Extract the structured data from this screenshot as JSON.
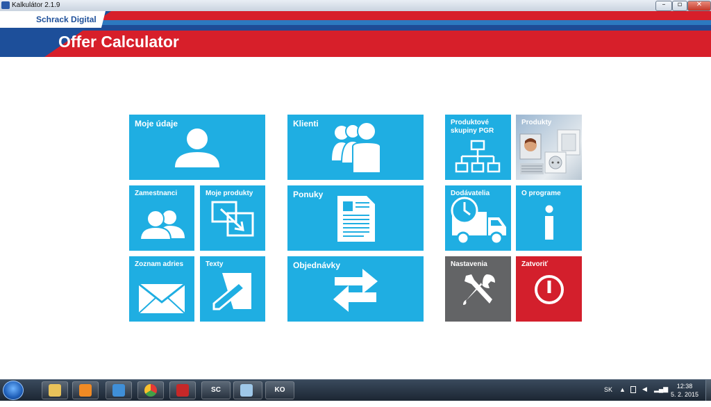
{
  "window": {
    "title": "Kalkulátor 2.1.9",
    "minimize": "–",
    "maximize": "▫",
    "close": "✕"
  },
  "header": {
    "brand": "Schrack Digital",
    "title": "Offer Calculator"
  },
  "tiles": {
    "moje_udaje": "Moje údaje",
    "zamestnanci": "Zamestnanci",
    "moje_produkty": "Moje produkty",
    "zoznam_adries": "Zoznam adries",
    "texty": "Texty",
    "klienti": "Klienti",
    "ponuky": "Ponuky",
    "objednavky": "Objednávky",
    "produktove_skupiny": "Produktové skupiny PGR",
    "produkty": "Produkty",
    "dodavatelia": "Dodávatelia",
    "o_programe": "O programe",
    "nastavenia": "Nastavenia",
    "zatvorit": "Zatvoriť"
  },
  "taskbar": {
    "apps": [
      {
        "icon": "folder-icon"
      },
      {
        "icon": "media-player-icon"
      },
      {
        "icon": "paint-icon"
      },
      {
        "icon": "chrome-icon"
      },
      {
        "icon": "autocad-icon"
      },
      {
        "icon": "sc-icon",
        "label": "SC"
      },
      {
        "icon": "notebook-icon"
      },
      {
        "icon": "ko-icon",
        "label": "KO"
      }
    ],
    "language": "SK",
    "time": "12:38",
    "date": "5. 2. 2015"
  },
  "colors": {
    "tile_blue": "#1faee2",
    "tile_gray": "#636466",
    "tile_red": "#d31f2c",
    "header_red": "#d71f2a",
    "header_blue": "#1d4f9a"
  }
}
